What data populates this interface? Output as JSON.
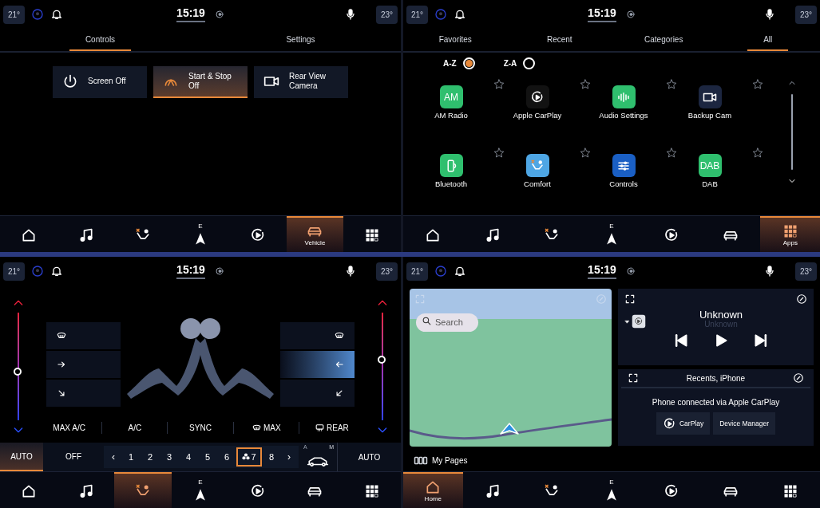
{
  "screens": [
    {
      "kind": "vehicle",
      "status_bar": {
        "outside_temp": "21°",
        "time": "15:19",
        "cabin_temp": "23°"
      },
      "tabs": [
        {
          "label": "Controls",
          "selected": true
        },
        {
          "label": "Settings",
          "selected": false
        }
      ],
      "buttons": [
        {
          "label": "Screen Off",
          "selected": false
        },
        {
          "label": "Start & Stop Off",
          "selected": true
        },
        {
          "label": "Rear View Camera",
          "selected": false
        }
      ],
      "nav": [
        {
          "selected": false
        },
        {
          "selected": false
        },
        {
          "selected": false
        },
        {
          "selected": false,
          "heading": "E"
        },
        {
          "selected": false
        },
        {
          "selected": true,
          "label": "Vehicle"
        },
        {
          "selected": false
        }
      ]
    },
    {
      "kind": "apps",
      "status_bar": {
        "outside_temp": "21°",
        "time": "15:19",
        "cabin_temp": "23°"
      },
      "tabs": [
        {
          "label": "Favorites",
          "selected": false
        },
        {
          "label": "Recent",
          "selected": false
        },
        {
          "label": "Categories",
          "selected": false
        },
        {
          "label": "All",
          "selected": true
        }
      ],
      "sort": [
        {
          "label": "A-Z",
          "selected": true
        },
        {
          "label": "Z-A",
          "selected": false
        }
      ],
      "apps": [
        {
          "label": "AM Radio",
          "badge": "AM",
          "color": "#2fbf6e",
          "favorite": false
        },
        {
          "label": "Apple CarPlay",
          "color": "#121212",
          "favorite": false
        },
        {
          "label": "Audio Settings",
          "color": "#2fbf6e",
          "favorite": false
        },
        {
          "label": "Backup Cam",
          "color": "#1c2640",
          "favorite": false
        },
        {
          "label": "Bluetooth",
          "color": "#2fbf6e",
          "favorite": false
        },
        {
          "label": "Comfort",
          "color": "#4ea6e4",
          "favorite": false
        },
        {
          "label": "Controls",
          "color": "#1a5fc4",
          "favorite": false
        },
        {
          "label": "DAB",
          "badge": "DAB",
          "color": "#2fbf6e",
          "favorite": false
        }
      ],
      "nav": [
        {
          "selected": false
        },
        {
          "selected": false
        },
        {
          "selected": false
        },
        {
          "selected": false,
          "heading": "E"
        },
        {
          "selected": false
        },
        {
          "selected": false
        },
        {
          "selected": true,
          "label": "Apps"
        }
      ]
    },
    {
      "kind": "climate",
      "status_bar": {
        "outside_temp": "21°",
        "time": "15:19",
        "cabin_temp": "23°"
      },
      "driver_temp": {
        "level": 0.45
      },
      "passenger_temp": {
        "level": 0.56
      },
      "airflow_left": [
        {
          "selected": false
        },
        {
          "selected": false
        },
        {
          "selected": false
        }
      ],
      "airflow_right": [
        {
          "selected": false
        },
        {
          "selected": true
        },
        {
          "selected": false
        }
      ],
      "buttons": [
        {
          "label": "MAX A/C",
          "kind": "text"
        },
        {
          "label": "A/C",
          "kind": "text"
        },
        {
          "label": "SYNC",
          "kind": "text"
        },
        {
          "label": "MAX",
          "kind": "front-defrost"
        },
        {
          "label": "REAR",
          "kind": "rear-defrost"
        }
      ],
      "fan": {
        "auto": {
          "label": "AUTO",
          "selected": true
        },
        "off": {
          "label": "OFF",
          "selected": false
        },
        "prev": "‹",
        "next": "›",
        "speeds": [
          {
            "label": "1",
            "selected": false
          },
          {
            "label": "2",
            "selected": false
          },
          {
            "label": "3",
            "selected": false
          },
          {
            "label": "4",
            "selected": false
          },
          {
            "label": "5",
            "selected": false
          },
          {
            "label": "6",
            "selected": false
          },
          {
            "label": "7",
            "selected": true
          },
          {
            "label": "8",
            "selected": false
          }
        ],
        "recirc": {
          "auto_mark": "A",
          "manual_mark": "M"
        },
        "auto_right": "AUTO"
      },
      "nav": [
        {
          "selected": false
        },
        {
          "selected": false
        },
        {
          "selected": true
        },
        {
          "selected": false,
          "heading": "E"
        },
        {
          "selected": false
        },
        {
          "selected": false
        },
        {
          "selected": false
        }
      ]
    },
    {
      "kind": "home",
      "status_bar": {
        "outside_temp": "21°",
        "time": "15:19",
        "cabin_temp": "23°"
      },
      "map": {
        "search": {
          "placeholder": "Search"
        }
      },
      "media": {
        "title": "Unknown",
        "subtitle": "Unknown"
      },
      "phone": {
        "title": "Recents, iPhone",
        "message": "Phone connected via Apple CarPlay",
        "buttons": [
          "CarPlay",
          "Device Manager"
        ]
      },
      "my_pages": "My Pages",
      "nav": [
        {
          "selected": true,
          "label": "Home"
        },
        {
          "selected": false
        },
        {
          "selected": false
        },
        {
          "selected": false,
          "heading": "E"
        },
        {
          "selected": false
        },
        {
          "selected": false
        },
        {
          "selected": false
        }
      ]
    }
  ]
}
